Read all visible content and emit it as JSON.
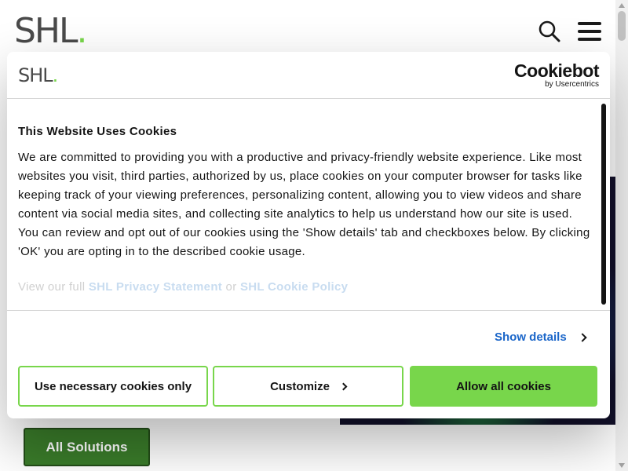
{
  "site": {
    "logo_text": "SHL",
    "logo_dot": ".",
    "all_solutions_label": "All Solutions"
  },
  "cookie_dialog": {
    "logo_text": "SHL",
    "logo_dot": ".",
    "brand_name": "Cookiebot",
    "brand_sub": "by Usercentrics",
    "title": "This Website Uses Cookies",
    "body_text": "We are committed to providing you with a productive and privacy-friendly website experience. Like most websites you visit, third parties, authorized by us, place cookies on your computer browser for tasks like keeping track of your viewing preferences, personalizing content, allowing you to view videos and share content via social media sites, and collecting site analytics to help us understand how our site is used. You can review and opt out of our cookies using the 'Show details' tab and checkboxes below. By clicking 'OK' you are opting in to the described cookie usage.",
    "links_prefix": "View our full",
    "privacy_link": "SHL Privacy Statement",
    "links_or": "or",
    "cookie_policy_link": "SHL Cookie Policy",
    "show_details_label": "Show details",
    "buttons": {
      "necessary": "Use necessary cookies only",
      "customize": "Customize",
      "allow_all": "Allow all cookies"
    }
  },
  "colors": {
    "accent_green": "#78d64b",
    "link_blue": "#1b66c9",
    "solutions_green": "#3a7c2a"
  }
}
